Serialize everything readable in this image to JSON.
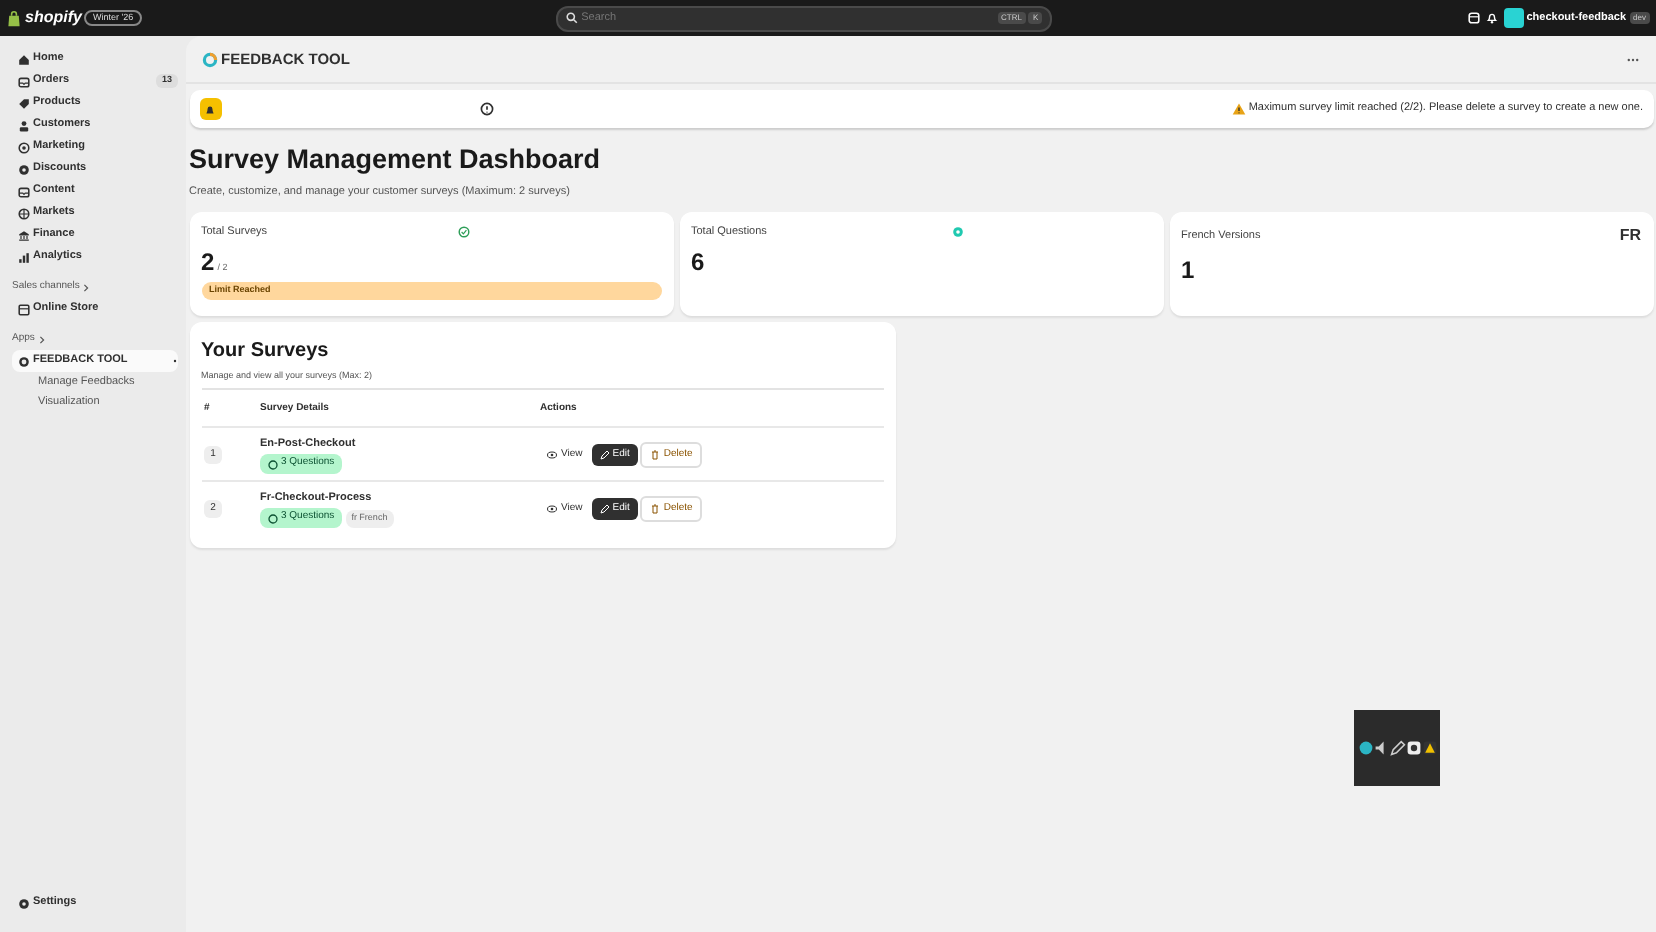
{
  "topbar": {
    "brand": "shopify",
    "edition": "Winter '26",
    "search_placeholder": "Search",
    "shortcut_keys": [
      "CTRL",
      "K"
    ],
    "store_name": "checkout-feedback",
    "store_badge": "dev"
  },
  "sidebar": {
    "items": [
      {
        "label": "Home"
      },
      {
        "label": "Orders",
        "count": "13"
      },
      {
        "label": "Products"
      },
      {
        "label": "Customers"
      },
      {
        "label": "Marketing"
      },
      {
        "label": "Discounts"
      },
      {
        "label": "Content"
      },
      {
        "label": "Markets"
      },
      {
        "label": "Finance"
      },
      {
        "label": "Analytics"
      }
    ],
    "sales_heading": "Sales channels",
    "sales_items": [
      {
        "label": "Online Store"
      }
    ],
    "apps_heading": "Apps",
    "app": {
      "label": "FEEDBACK TOOL",
      "selected": true,
      "children": [
        {
          "label": "Manage Feedbacks"
        },
        {
          "label": "Visualization"
        }
      ]
    },
    "settings": "Settings"
  },
  "app_title": "FEEDBACK TOOL",
  "alert": {
    "message": "Maximum survey limit reached (2/2). Please delete a survey to create a new one."
  },
  "heading": "Survey Management Dashboard",
  "subheading": "Create, customize, and manage your customer surveys (Maximum: 2 surveys)",
  "stats": [
    {
      "label": "Total Surveys",
      "value": "2",
      "suffix": "/ 2",
      "kind": "check",
      "badge": "Limit Reached"
    },
    {
      "label": "Total Questions",
      "value": "6",
      "kind": "dot"
    },
    {
      "label": "French Versions",
      "value": "1",
      "kind": "code",
      "code": "FR"
    }
  ],
  "surveys": {
    "title": "Your Surveys",
    "subtitle": "Manage and view all your surveys (Max: 2)",
    "columns": [
      "#",
      "Survey Details",
      "Actions"
    ],
    "rows": [
      {
        "index": "1",
        "name": "En-Post-Checkout",
        "questions": "3 Questions",
        "actions": [
          "View",
          "Edit",
          "Delete"
        ]
      },
      {
        "index": "2",
        "name": "Fr-Checkout-Process",
        "questions": "3 Questions",
        "language": "fr French",
        "actions": [
          "View",
          "Edit",
          "Delete"
        ]
      }
    ]
  }
}
